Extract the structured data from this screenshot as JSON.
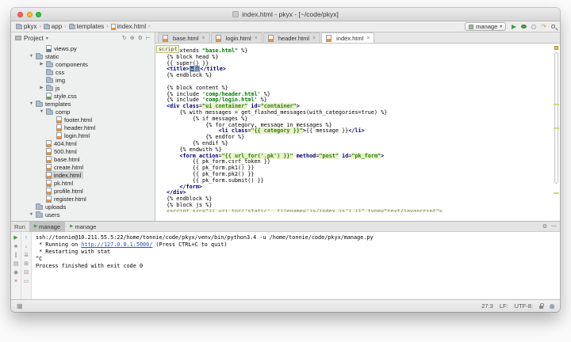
{
  "window": {
    "title": "index.html - pkyx - [~/code/pkyx]"
  },
  "toolbar": {
    "separator": "›",
    "caret_glyph": "▾",
    "breadcrumbs": [
      {
        "label": "pkyx",
        "icon": "folder"
      },
      {
        "label": "app",
        "icon": "folder"
      },
      {
        "label": "templates",
        "icon": "folder"
      },
      {
        "label": "index.html",
        "icon": "html"
      }
    ],
    "run_config": "manage",
    "icons": [
      {
        "name": "run-icon",
        "shape": "play"
      },
      {
        "name": "debug-icon",
        "shape": "bug"
      },
      {
        "name": "coverage-icon",
        "shape": "ring"
      },
      {
        "name": "rerun-deploy-icon",
        "glyph": "↷",
        "color": "#c79f4e"
      },
      {
        "name": "search-icon",
        "shape": "magnifier"
      }
    ]
  },
  "project_panel": {
    "title": "Project",
    "open_arrow": "▼",
    "closed_arrow": "▶",
    "header_icons": [
      {
        "name": "sync-icon",
        "glyph": "↻"
      },
      {
        "name": "locate-icon",
        "glyph": "⊕"
      },
      {
        "name": "settings-gear-icon",
        "glyph": "⚙"
      },
      {
        "name": "hide-panel-icon",
        "glyph": "⊢"
      }
    ],
    "tree": [
      {
        "label": "views.py",
        "depth": 2,
        "icon": "py",
        "arrow": ""
      },
      {
        "label": "static",
        "depth": 1,
        "icon": "folder",
        "arrow": "open"
      },
      {
        "label": "components",
        "depth": 2,
        "icon": "folder",
        "arrow": "closed"
      },
      {
        "label": "css",
        "depth": 2,
        "icon": "folder",
        "arrow": ""
      },
      {
        "label": "img",
        "depth": 2,
        "icon": "folder",
        "arrow": ""
      },
      {
        "label": "js",
        "depth": 2,
        "icon": "folder",
        "arrow": "closed"
      },
      {
        "label": "style.css",
        "depth": 2,
        "icon": "css",
        "arrow": ""
      },
      {
        "label": "templates",
        "depth": 1,
        "icon": "folder",
        "arrow": "open"
      },
      {
        "label": "comp",
        "depth": 2,
        "icon": "folder",
        "arrow": "open"
      },
      {
        "label": "footer.html",
        "depth": 3,
        "icon": "html",
        "arrow": ""
      },
      {
        "label": "header.html",
        "depth": 3,
        "icon": "html",
        "arrow": ""
      },
      {
        "label": "login.html",
        "depth": 3,
        "icon": "html",
        "arrow": ""
      },
      {
        "label": "404.html",
        "depth": 2,
        "icon": "html",
        "arrow": ""
      },
      {
        "label": "500.html",
        "depth": 2,
        "icon": "html",
        "arrow": ""
      },
      {
        "label": "base.html",
        "depth": 2,
        "icon": "html",
        "arrow": ""
      },
      {
        "label": "create.html",
        "depth": 2,
        "icon": "html",
        "arrow": ""
      },
      {
        "label": "index.html",
        "depth": 2,
        "icon": "html",
        "arrow": "",
        "selected": true
      },
      {
        "label": "pk.html",
        "depth": 2,
        "icon": "html",
        "arrow": ""
      },
      {
        "label": "profile.html",
        "depth": 2,
        "icon": "html",
        "arrow": ""
      },
      {
        "label": "register.html",
        "depth": 2,
        "icon": "html",
        "arrow": ""
      },
      {
        "label": "uploads",
        "depth": 1,
        "icon": "folder",
        "arrow": ""
      },
      {
        "label": "users",
        "depth": 1,
        "icon": "folder",
        "arrow": "open"
      }
    ]
  },
  "editor": {
    "tab_close_glyph": "×",
    "tabs": [
      {
        "label": "base.html",
        "active": false
      },
      {
        "label": "login.html",
        "active": false
      },
      {
        "label": "header.html",
        "active": false
      },
      {
        "label": "index.html",
        "active": true
      }
    ],
    "tag_hint": "script",
    "lines": [
      {
        "seg": [
          [
            "p",
            "{% extends "
          ],
          [
            "s",
            "\"base.html\""
          ],
          [
            "p",
            " %}"
          ]
        ]
      },
      {
        "seg": [
          [
            "p",
            "{% block head %}"
          ]
        ]
      },
      {
        "seg": [
          [
            "p",
            "{{ super() }}"
          ]
        ]
      },
      {
        "seg": [
          [
            "t",
            "<title>"
          ],
          [
            "sel",
            "首页"
          ],
          [
            "t",
            "</title>"
          ]
        ]
      },
      {
        "seg": [
          [
            "p",
            "{% endblock %}"
          ]
        ]
      },
      {
        "seg": [
          [
            "p",
            ""
          ]
        ]
      },
      {
        "seg": [
          [
            "p",
            "{% block content %}"
          ]
        ]
      },
      {
        "seg": [
          [
            "p",
            "{% include "
          ],
          [
            "s",
            "'comp/header.html'"
          ],
          [
            "p",
            " %}"
          ]
        ]
      },
      {
        "seg": [
          [
            "p",
            "{% include "
          ],
          [
            "s",
            "'comp/login.html'"
          ],
          [
            "p",
            " %}"
          ]
        ]
      },
      {
        "seg": [
          [
            "t",
            "<div"
          ],
          [
            "p",
            " "
          ],
          [
            "a",
            "class"
          ],
          [
            "p",
            "="
          ],
          [
            "v",
            "\"ui container\""
          ],
          [
            "p",
            " "
          ],
          [
            "a",
            "id"
          ],
          [
            "p",
            "="
          ],
          [
            "v",
            "\"container\""
          ],
          [
            "t",
            ">"
          ]
        ]
      },
      {
        "seg": [
          [
            "p",
            "    {% with messages = get_flashed_messages(with_categories=true) %}"
          ]
        ]
      },
      {
        "seg": [
          [
            "p",
            "        {% if messages %}"
          ]
        ]
      },
      {
        "seg": [
          [
            "p",
            "            {% for category, message in messages %}"
          ]
        ]
      },
      {
        "seg": [
          [
            "p",
            "                "
          ],
          [
            "t",
            "<li"
          ],
          [
            "p",
            " "
          ],
          [
            "a",
            "class"
          ],
          [
            "p",
            "="
          ],
          [
            "v",
            "\"{{ category }}\""
          ],
          [
            "t",
            ">"
          ],
          [
            "p",
            "{{ message }}"
          ],
          [
            "t",
            "</li>"
          ]
        ]
      },
      {
        "seg": [
          [
            "p",
            "            {% endfor %}"
          ]
        ]
      },
      {
        "seg": [
          [
            "p",
            "        {% endif %}"
          ]
        ]
      },
      {
        "seg": [
          [
            "p",
            "    {% endwith %}"
          ]
        ]
      },
      {
        "seg": [
          [
            "p",
            "    "
          ],
          [
            "t",
            "<form"
          ],
          [
            "p",
            " "
          ],
          [
            "a",
            "action"
          ],
          [
            "p",
            "="
          ],
          [
            "v",
            "\"{{ url_for('.pk') }}\""
          ],
          [
            "p",
            " "
          ],
          [
            "a",
            "method"
          ],
          [
            "p",
            "="
          ],
          [
            "v",
            "\"post\""
          ],
          [
            "p",
            " "
          ],
          [
            "a",
            "id"
          ],
          [
            "p",
            "="
          ],
          [
            "v",
            "\"pk_form\""
          ],
          [
            "t",
            ">"
          ]
        ]
      },
      {
        "seg": [
          [
            "p",
            "        {{ pk_form.csrf_token }}"
          ]
        ]
      },
      {
        "seg": [
          [
            "p",
            "        {{ pk_form.pk1() }}"
          ]
        ]
      },
      {
        "seg": [
          [
            "p",
            "        {{ pk_form.pk2() }}"
          ]
        ]
      },
      {
        "seg": [
          [
            "p",
            "        {{ pk_form.submit() }}"
          ]
        ]
      },
      {
        "seg": [
          [
            "p",
            "    "
          ],
          [
            "t",
            "</form>"
          ]
        ]
      },
      {
        "seg": [
          [
            "t",
            "</div>"
          ]
        ]
      },
      {
        "seg": [
          [
            "p",
            "{% endblock %}"
          ]
        ]
      },
      {
        "seg": [
          [
            "p",
            "{% block js %}"
          ]
        ]
      },
      {
        "cut": true,
        "seg": [
          [
            "hl",
            "<script src=\"{{ url_for('static', filename='js/index.js') }}\" type=\"text/javascript\">"
          ]
        ]
      }
    ]
  },
  "run_panel": {
    "label": "Run",
    "tab_icon_glyph": "▶",
    "tabs": [
      {
        "label": "manage",
        "active": true
      },
      {
        "label": "manage",
        "active": false
      }
    ],
    "toolbar_primary": [
      {
        "name": "rerun-icon",
        "glyph": "▶",
        "color": "#3f9b44"
      },
      {
        "name": "stop-icon",
        "glyph": "■",
        "color": "#9b9b9b"
      },
      {
        "name": "pause-icon",
        "glyph": "∥",
        "color": "#7d93a8"
      },
      {
        "name": "restore-layout-icon",
        "glyph": "▤",
        "color": "#888888"
      },
      {
        "name": "pin-icon",
        "glyph": "◉",
        "color": "#888888"
      },
      {
        "name": "close-icon",
        "glyph": "×",
        "color": "#c0443e"
      }
    ],
    "toolbar_secondary": [
      {
        "name": "up-stack-trace-icon",
        "glyph": "↑",
        "color": "#4a7ab5"
      },
      {
        "name": "down-stack-trace-icon",
        "glyph": "↓",
        "color": "#4a7ab5"
      },
      {
        "name": "scroll-to-end-icon",
        "glyph": "⇊",
        "color": "#888888"
      },
      {
        "name": "print-icon",
        "glyph": "⊞",
        "color": "#888888"
      },
      {
        "name": "soft-wrap-icon",
        "glyph": "⊟",
        "color": "#888888"
      },
      {
        "name": "clear-console-icon",
        "glyph": "▭",
        "color": "#888888"
      }
    ],
    "header_icons": [
      {
        "name": "run-settings-gear-icon",
        "glyph": "⚙"
      },
      {
        "name": "minimize-panel-icon",
        "glyph": "—"
      }
    ],
    "console": [
      {
        "seg": [
          [
            "p",
            "ssh://tonnie@10.211.55.5:22/home/tonnie/code/pkyx/venv/bin/python3.4 -u /home/tonnie/code/pkyx/manage.py"
          ]
        ]
      },
      {
        "seg": [
          [
            "p",
            " * Running on "
          ],
          [
            "link",
            "http://127.0.0.1:5000/"
          ],
          [
            "p",
            " (Press CTRL+C to quit)"
          ]
        ]
      },
      {
        "seg": [
          [
            "p",
            " * Restarting with stat"
          ]
        ]
      },
      {
        "seg": [
          [
            "p",
            "^C"
          ]
        ]
      },
      {
        "seg": [
          [
            "p",
            "Process finished with exit code 0"
          ]
        ]
      }
    ]
  },
  "status_bar": {
    "toggle": "▦",
    "caret": "27:3",
    "line_sep": "LF:",
    "encoding": "UTF-8:"
  },
  "colors": {
    "accent_green": "#3f9b44",
    "string_green": "#008000",
    "tag_navy": "#000080",
    "attr_value_bg": "#e8f2cd",
    "selection_blue": "#a6c8f2",
    "stripe_yellow": "#e3c53f"
  }
}
